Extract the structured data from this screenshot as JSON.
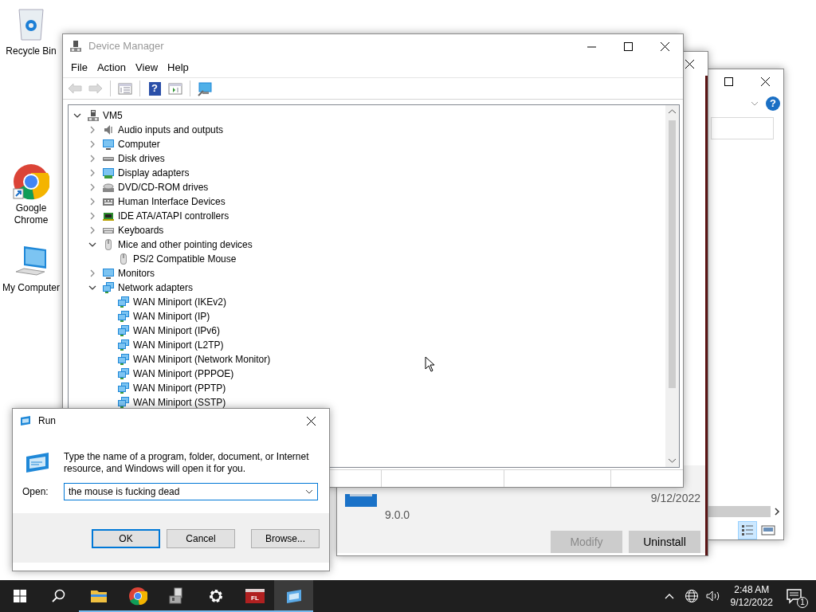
{
  "desktop_icons": [
    {
      "label": "Recycle Bin",
      "kind": "recycle"
    },
    {
      "label": "Google Chrome",
      "kind": "chrome"
    },
    {
      "label": "My Computer",
      "kind": "computer"
    }
  ],
  "back_window": {
    "help_glyph": "?",
    "views": [
      {
        "kind": "details",
        "selected": true
      },
      {
        "kind": "tiles",
        "selected": false
      }
    ]
  },
  "apps_window": {
    "version": "9.0.0",
    "date": "9/12/2022",
    "buttons": [
      {
        "label": "Modify",
        "disabled": true
      },
      {
        "label": "Uninstall",
        "disabled": false
      }
    ]
  },
  "device_manager": {
    "title": "Device Manager",
    "menu": [
      "File",
      "Action",
      "View",
      "Help"
    ],
    "toolbar": [
      {
        "kind": "back",
        "disabled": true
      },
      {
        "kind": "forward",
        "disabled": true
      },
      {
        "kind": "console",
        "disabled": false
      },
      {
        "kind": "help",
        "glyph": "?",
        "disabled": false
      },
      {
        "kind": "action",
        "disabled": false
      },
      {
        "kind": "scan",
        "disabled": false
      }
    ],
    "tree": {
      "label": "VM5",
      "kind": "pc",
      "expanded": true,
      "children": [
        {
          "label": "Audio inputs and outputs",
          "kind": "audio",
          "expanded": false
        },
        {
          "label": "Computer",
          "kind": "computer",
          "expanded": false
        },
        {
          "label": "Disk drives",
          "kind": "disk",
          "expanded": false
        },
        {
          "label": "Display adapters",
          "kind": "display",
          "expanded": false
        },
        {
          "label": "DVD/CD-ROM drives",
          "kind": "dvd",
          "expanded": false
        },
        {
          "label": "Human Interface Devices",
          "kind": "hid",
          "expanded": false
        },
        {
          "label": "IDE ATA/ATAPI controllers",
          "kind": "ide",
          "expanded": false
        },
        {
          "label": "Keyboards",
          "kind": "keyboard",
          "expanded": false
        },
        {
          "label": "Mice and other pointing devices",
          "kind": "mouse",
          "expanded": true,
          "children": [
            {
              "label": "PS/2 Compatible Mouse",
              "kind": "mouse"
            }
          ]
        },
        {
          "label": "Monitors",
          "kind": "computer",
          "expanded": false
        },
        {
          "label": "Network adapters",
          "kind": "network",
          "expanded": true,
          "children": [
            {
              "label": "WAN Miniport (IKEv2)",
              "kind": "network"
            },
            {
              "label": "WAN Miniport (IP)",
              "kind": "network"
            },
            {
              "label": "WAN Miniport (IPv6)",
              "kind": "network"
            },
            {
              "label": "WAN Miniport (L2TP)",
              "kind": "network"
            },
            {
              "label": "WAN Miniport (Network Monitor)",
              "kind": "network"
            },
            {
              "label": "WAN Miniport (PPPOE)",
              "kind": "network"
            },
            {
              "label": "WAN Miniport (PPTP)",
              "kind": "network"
            },
            {
              "label": "WAN Miniport (SSTP)",
              "kind": "network"
            }
          ]
        }
      ]
    }
  },
  "run_dialog": {
    "title": "Run",
    "description": "Type the name of a program, folder, document, or Internet resource, and Windows will open it for you.",
    "open_label": "Open:",
    "value": "the mouse is fucking dead",
    "buttons": [
      {
        "label": "OK",
        "default": true
      },
      {
        "label": "Cancel",
        "default": false
      },
      {
        "label": "Browse...",
        "default": false
      }
    ]
  },
  "taskbar": {
    "apps": [
      {
        "kind": "explorer",
        "running": true,
        "selected": false
      },
      {
        "kind": "chrome",
        "running": true,
        "selected": false
      },
      {
        "kind": "device",
        "running": true,
        "selected": false
      },
      {
        "kind": "settings",
        "running": true,
        "selected": false
      },
      {
        "kind": "fl",
        "badge_text": "FL",
        "running": true,
        "selected": false
      },
      {
        "kind": "run",
        "running": true,
        "selected": true
      }
    ],
    "time": "2:48 AM",
    "date": "9/12/2022",
    "notification_count": "1"
  }
}
